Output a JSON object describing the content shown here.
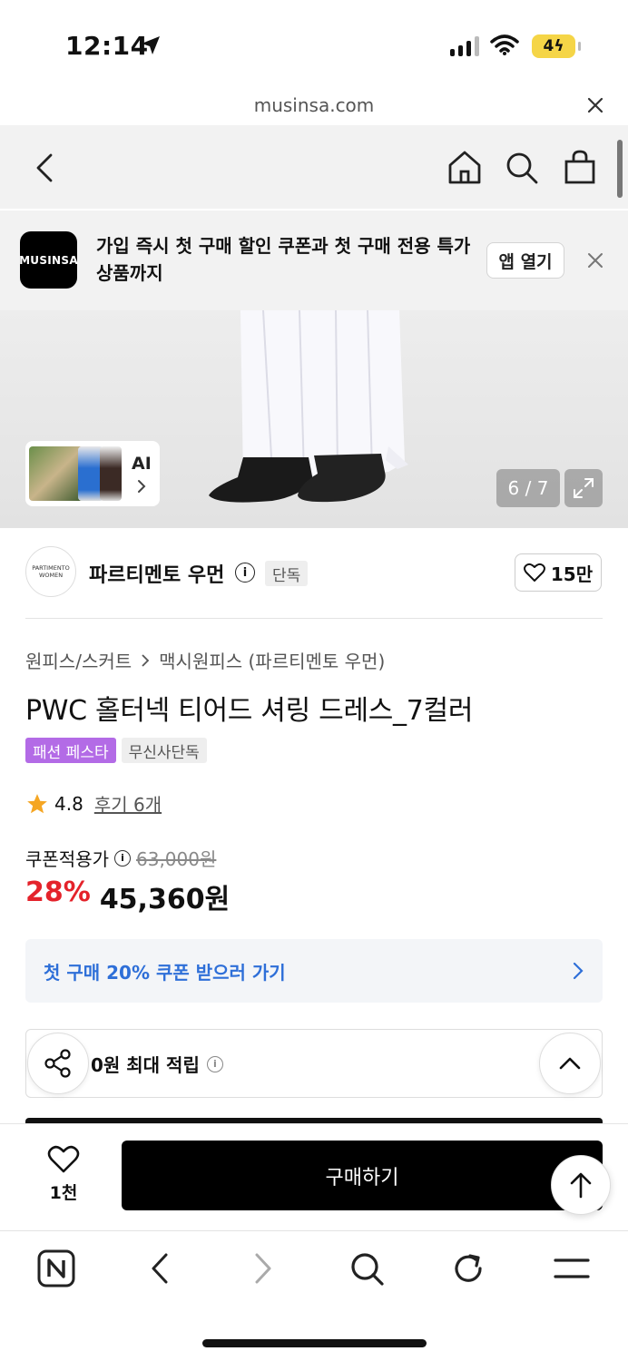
{
  "status_bar": {
    "time": "12:14",
    "battery": "4"
  },
  "browser": {
    "url": "musinsa.com"
  },
  "banner": {
    "logo_text": "MUSINSA",
    "message": "가입 즉시 첫 구매 할인 쿠폰과 첫 구매 전용 특가 상품까지",
    "open_app_label": "앱 열기"
  },
  "gallery": {
    "ai_label": "AI",
    "counter": "6 / 7"
  },
  "brand": {
    "logo_line1": "PARTIMENTO",
    "logo_line2": "WOMEN",
    "name": "파르티멘토 우먼",
    "exclusive_label": "단독",
    "likes": "15만"
  },
  "product": {
    "breadcrumb_1": "원피스/스커트",
    "breadcrumb_2": "맥시원피스 (파르티멘토 우먼)",
    "title": "PWC 홀터넥 티어드 셔링 드레스_7컬러",
    "badge_1": "패션 페스타",
    "badge_2": "무신사단독",
    "rating": "4.8",
    "review_label": "후기 6개",
    "price_label": "쿠폰적용가",
    "original_price": "63,000원",
    "discount": "28%",
    "price": "45,360원",
    "coupon_text": "첫 구매 20% 쿠폰 받으러 가기",
    "points_text": "0원 최대 적립"
  },
  "purchase_bar": {
    "wish_count": "1천",
    "buy_label": "구매하기"
  },
  "colors": {
    "discount": "#e4232b",
    "coupon": "#2e6fd8",
    "badge_purple": "#b36be6",
    "star": "#f5a623"
  }
}
